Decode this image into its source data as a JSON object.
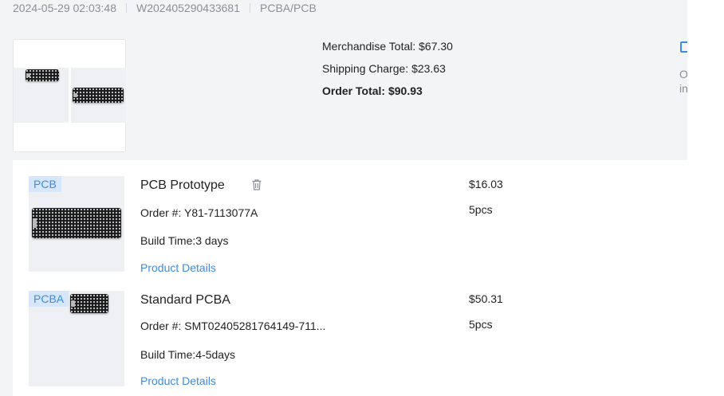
{
  "order": {
    "datetime": "2024-05-29 02:03:48",
    "order_id": "W202405290433681",
    "category": "PCBA/PCB"
  },
  "summary": {
    "merchandise_total": "Merchandise Total: $67.30",
    "shipping_charge": "Shipping Charge: $23.63",
    "order_total": "Order Total: $90.93"
  },
  "side_panel": {
    "line1": "O",
    "line2": "in",
    "icon": "document-icon",
    "accent": "#3d8be0"
  },
  "items": [
    {
      "tag": "PCB",
      "name": "PCB Prototype",
      "order_no": "Order #: Y81-7113077A",
      "build_time": "Build Time:3 days",
      "details_link": "Product Details",
      "price": "$16.03",
      "qty": "5pcs",
      "delete_icon": "trash-icon"
    },
    {
      "tag": "PCBA",
      "name": "Standard PCBA",
      "order_no": "Order #: SMT02405281764149-711...",
      "build_time": "Build Time:4-5days",
      "details_link": "Product Details",
      "price": "$50.31",
      "qty": "5pcs"
    }
  ],
  "colors": {
    "link": "#3d8be0",
    "tag_bg": "#d6e6fb",
    "muted": "#8a8f99",
    "panel_bg": "#f3f4f6"
  }
}
